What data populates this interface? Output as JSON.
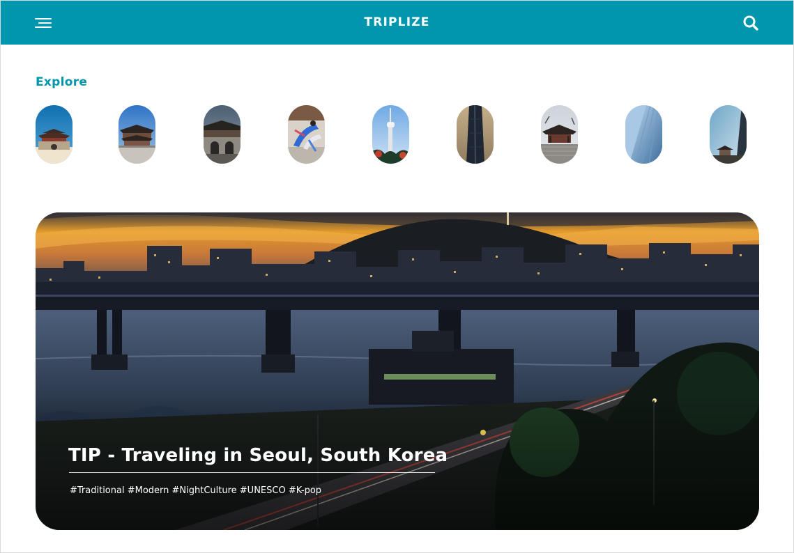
{
  "header": {
    "title": "TRIPLIZE",
    "menu_icon": "hamburger-menu-icon",
    "search_icon": "search-icon",
    "background": "#0097ae"
  },
  "explore": {
    "heading": "Explore",
    "accent": "#0097ae",
    "items": [
      {
        "name": "traditional-gate"
      },
      {
        "name": "palace-hall"
      },
      {
        "name": "palace-gate-stone"
      },
      {
        "name": "traditional-dance"
      },
      {
        "name": "seoul-tower"
      },
      {
        "name": "skyscraper-dark"
      },
      {
        "name": "pavilion"
      },
      {
        "name": "glass-skyscraper"
      },
      {
        "name": "tower-and-temple"
      }
    ]
  },
  "feature": {
    "title": "TIP - Traveling in Seoul, South Korea",
    "tags": "#Traditional #Modern #NightCulture #UNESCO #K-pop"
  }
}
